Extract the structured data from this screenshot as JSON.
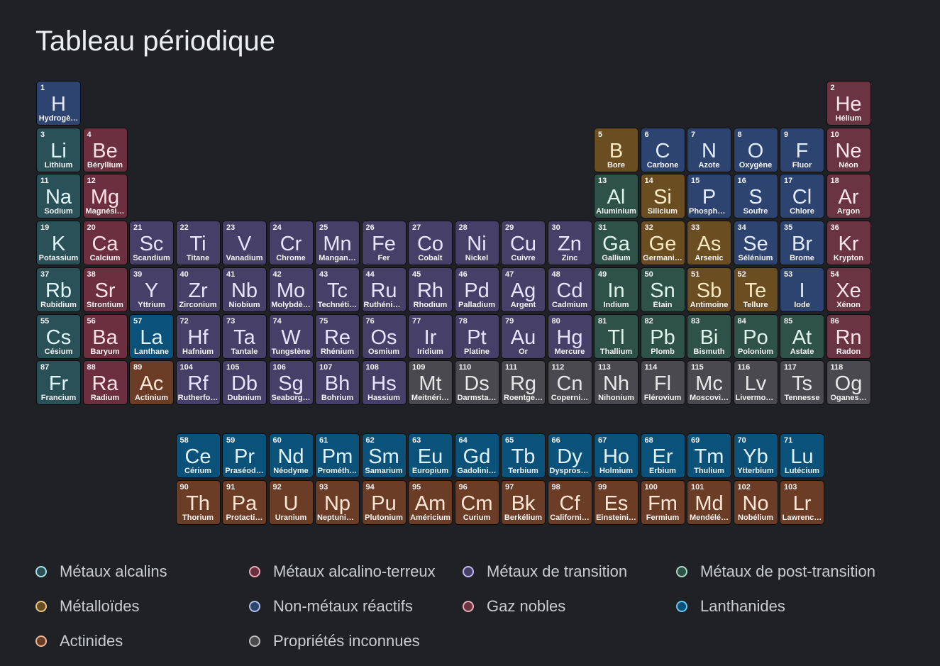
{
  "title": "Tableau périodique",
  "categories": {
    "alkali": {
      "label": "Métaux alcalins",
      "bg": "#2a5058",
      "fg": "#dff6f8",
      "dot": "#a8dfe4"
    },
    "alkaline": {
      "label": "Métaux alcalino-terreux",
      "bg": "#6c2f3f",
      "fg": "#ffe1e6",
      "dot": "#e8aab6"
    },
    "transition": {
      "label": "Métaux de transition",
      "bg": "#463f68",
      "fg": "#e8e4ff",
      "dot": "#c4b8f0"
    },
    "post": {
      "label": "Métaux de post-transition",
      "bg": "#2f5248",
      "fg": "#def3ea",
      "dot": "#a8d8c4"
    },
    "metalloid": {
      "label": "Métalloïdes",
      "bg": "#6b4d22",
      "fg": "#fbe9c2",
      "dot": "#e2c98a"
    },
    "nonmetal": {
      "label": "Non-métaux réactifs",
      "bg": "#2e4470",
      "fg": "#e2eaff",
      "dot": "#aebfe8"
    },
    "noble": {
      "label": "Gaz nobles",
      "bg": "#6a3442",
      "fg": "#ffe4ea",
      "dot": "#e6aebb"
    },
    "lanthanide": {
      "label": "Lanthanides",
      "bg": "#0b527a",
      "fg": "#dff2ff",
      "dot": "#6fc8ef"
    },
    "actinide": {
      "label": "Actinides",
      "bg": "#6b3c26",
      "fg": "#ffe6d4",
      "dot": "#eeb899"
    },
    "unknown": {
      "label": "Propriétés inconnues",
      "bg": "#4a4a4e",
      "fg": "#e6e6e6",
      "dot": "#bdbdbd"
    }
  },
  "legend_order": [
    "alkali",
    "alkaline",
    "transition",
    "post",
    "metalloid",
    "nonmetal",
    "noble",
    "lanthanide",
    "actinide",
    "unknown"
  ],
  "elements": [
    {
      "n": 1,
      "s": "H",
      "name": "Hydrogè…",
      "cat": "nonmetal",
      "row": 1,
      "col": 1
    },
    {
      "n": 2,
      "s": "He",
      "name": "Hélium",
      "cat": "noble",
      "row": 1,
      "col": 18
    },
    {
      "n": 3,
      "s": "Li",
      "name": "Lithium",
      "cat": "alkali",
      "row": 2,
      "col": 1
    },
    {
      "n": 4,
      "s": "Be",
      "name": "Béryllium",
      "cat": "alkaline",
      "row": 2,
      "col": 2
    },
    {
      "n": 5,
      "s": "B",
      "name": "Bore",
      "cat": "metalloid",
      "row": 2,
      "col": 13
    },
    {
      "n": 6,
      "s": "C",
      "name": "Carbone",
      "cat": "nonmetal",
      "row": 2,
      "col": 14
    },
    {
      "n": 7,
      "s": "N",
      "name": "Azote",
      "cat": "nonmetal",
      "row": 2,
      "col": 15
    },
    {
      "n": 8,
      "s": "O",
      "name": "Oxygène",
      "cat": "nonmetal",
      "row": 2,
      "col": 16
    },
    {
      "n": 9,
      "s": "F",
      "name": "Fluor",
      "cat": "nonmetal",
      "row": 2,
      "col": 17
    },
    {
      "n": 10,
      "s": "Ne",
      "name": "Néon",
      "cat": "noble",
      "row": 2,
      "col": 18
    },
    {
      "n": 11,
      "s": "Na",
      "name": "Sodium",
      "cat": "alkali",
      "row": 3,
      "col": 1
    },
    {
      "n": 12,
      "s": "Mg",
      "name": "Magnési…",
      "cat": "alkaline",
      "row": 3,
      "col": 2
    },
    {
      "n": 13,
      "s": "Al",
      "name": "Aluminium",
      "cat": "post",
      "row": 3,
      "col": 13
    },
    {
      "n": 14,
      "s": "Si",
      "name": "Silicium",
      "cat": "metalloid",
      "row": 3,
      "col": 14
    },
    {
      "n": 15,
      "s": "P",
      "name": "Phosphore",
      "cat": "nonmetal",
      "row": 3,
      "col": 15
    },
    {
      "n": 16,
      "s": "S",
      "name": "Soufre",
      "cat": "nonmetal",
      "row": 3,
      "col": 16
    },
    {
      "n": 17,
      "s": "Cl",
      "name": "Chlore",
      "cat": "nonmetal",
      "row": 3,
      "col": 17
    },
    {
      "n": 18,
      "s": "Ar",
      "name": "Argon",
      "cat": "noble",
      "row": 3,
      "col": 18
    },
    {
      "n": 19,
      "s": "K",
      "name": "Potassium",
      "cat": "alkali",
      "row": 4,
      "col": 1
    },
    {
      "n": 20,
      "s": "Ca",
      "name": "Calcium",
      "cat": "alkaline",
      "row": 4,
      "col": 2
    },
    {
      "n": 21,
      "s": "Sc",
      "name": "Scandium",
      "cat": "transition",
      "row": 4,
      "col": 3
    },
    {
      "n": 22,
      "s": "Ti",
      "name": "Titane",
      "cat": "transition",
      "row": 4,
      "col": 4
    },
    {
      "n": 23,
      "s": "V",
      "name": "Vanadium",
      "cat": "transition",
      "row": 4,
      "col": 5
    },
    {
      "n": 24,
      "s": "Cr",
      "name": "Chrome",
      "cat": "transition",
      "row": 4,
      "col": 6
    },
    {
      "n": 25,
      "s": "Mn",
      "name": "Mangan…",
      "cat": "transition",
      "row": 4,
      "col": 7
    },
    {
      "n": 26,
      "s": "Fe",
      "name": "Fer",
      "cat": "transition",
      "row": 4,
      "col": 8
    },
    {
      "n": 27,
      "s": "Co",
      "name": "Cobalt",
      "cat": "transition",
      "row": 4,
      "col": 9
    },
    {
      "n": 28,
      "s": "Ni",
      "name": "Nickel",
      "cat": "transition",
      "row": 4,
      "col": 10
    },
    {
      "n": 29,
      "s": "Cu",
      "name": "Cuivre",
      "cat": "transition",
      "row": 4,
      "col": 11
    },
    {
      "n": 30,
      "s": "Zn",
      "name": "Zinc",
      "cat": "transition",
      "row": 4,
      "col": 12
    },
    {
      "n": 31,
      "s": "Ga",
      "name": "Gallium",
      "cat": "post",
      "row": 4,
      "col": 13
    },
    {
      "n": 32,
      "s": "Ge",
      "name": "Germani…",
      "cat": "metalloid",
      "row": 4,
      "col": 14
    },
    {
      "n": 33,
      "s": "As",
      "name": "Arsenic",
      "cat": "metalloid",
      "row": 4,
      "col": 15
    },
    {
      "n": 34,
      "s": "Se",
      "name": "Sélénium",
      "cat": "nonmetal",
      "row": 4,
      "col": 16
    },
    {
      "n": 35,
      "s": "Br",
      "name": "Brome",
      "cat": "nonmetal",
      "row": 4,
      "col": 17
    },
    {
      "n": 36,
      "s": "Kr",
      "name": "Krypton",
      "cat": "noble",
      "row": 4,
      "col": 18
    },
    {
      "n": 37,
      "s": "Rb",
      "name": "Rubidium",
      "cat": "alkali",
      "row": 5,
      "col": 1
    },
    {
      "n": 38,
      "s": "Sr",
      "name": "Strontium",
      "cat": "alkaline",
      "row": 5,
      "col": 2
    },
    {
      "n": 39,
      "s": "Y",
      "name": "Yttrium",
      "cat": "transition",
      "row": 5,
      "col": 3
    },
    {
      "n": 40,
      "s": "Zr",
      "name": "Zirconium",
      "cat": "transition",
      "row": 5,
      "col": 4
    },
    {
      "n": 41,
      "s": "Nb",
      "name": "Niobium",
      "cat": "transition",
      "row": 5,
      "col": 5
    },
    {
      "n": 42,
      "s": "Mo",
      "name": "Molybdè…",
      "cat": "transition",
      "row": 5,
      "col": 6
    },
    {
      "n": 43,
      "s": "Tc",
      "name": "Technéti…",
      "cat": "transition",
      "row": 5,
      "col": 7
    },
    {
      "n": 44,
      "s": "Ru",
      "name": "Ruthénium",
      "cat": "transition",
      "row": 5,
      "col": 8
    },
    {
      "n": 45,
      "s": "Rh",
      "name": "Rhodium",
      "cat": "transition",
      "row": 5,
      "col": 9
    },
    {
      "n": 46,
      "s": "Pd",
      "name": "Palladium",
      "cat": "transition",
      "row": 5,
      "col": 10
    },
    {
      "n": 47,
      "s": "Ag",
      "name": "Argent",
      "cat": "transition",
      "row": 5,
      "col": 11
    },
    {
      "n": 48,
      "s": "Cd",
      "name": "Cadmium",
      "cat": "transition",
      "row": 5,
      "col": 12
    },
    {
      "n": 49,
      "s": "In",
      "name": "Indium",
      "cat": "post",
      "row": 5,
      "col": 13
    },
    {
      "n": 50,
      "s": "Sn",
      "name": "Étain",
      "cat": "post",
      "row": 5,
      "col": 14
    },
    {
      "n": 51,
      "s": "Sb",
      "name": "Antimoine",
      "cat": "metalloid",
      "row": 5,
      "col": 15
    },
    {
      "n": 52,
      "s": "Te",
      "name": "Tellure",
      "cat": "metalloid",
      "row": 5,
      "col": 16
    },
    {
      "n": 53,
      "s": "I",
      "name": "Iode",
      "cat": "nonmetal",
      "row": 5,
      "col": 17
    },
    {
      "n": 54,
      "s": "Xe",
      "name": "Xénon",
      "cat": "noble",
      "row": 5,
      "col": 18
    },
    {
      "n": 55,
      "s": "Cs",
      "name": "Césium",
      "cat": "alkali",
      "row": 6,
      "col": 1
    },
    {
      "n": 56,
      "s": "Ba",
      "name": "Baryum",
      "cat": "alkaline",
      "row": 6,
      "col": 2
    },
    {
      "n": 57,
      "s": "La",
      "name": "Lanthane",
      "cat": "lanthanide",
      "row": 6,
      "col": 3
    },
    {
      "n": 72,
      "s": "Hf",
      "name": "Hafnium",
      "cat": "transition",
      "row": 6,
      "col": 4
    },
    {
      "n": 73,
      "s": "Ta",
      "name": "Tantale",
      "cat": "transition",
      "row": 6,
      "col": 5
    },
    {
      "n": 74,
      "s": "W",
      "name": "Tungstène",
      "cat": "transition",
      "row": 6,
      "col": 6
    },
    {
      "n": 75,
      "s": "Re",
      "name": "Rhénium",
      "cat": "transition",
      "row": 6,
      "col": 7
    },
    {
      "n": 76,
      "s": "Os",
      "name": "Osmium",
      "cat": "transition",
      "row": 6,
      "col": 8
    },
    {
      "n": 77,
      "s": "Ir",
      "name": "Iridium",
      "cat": "transition",
      "row": 6,
      "col": 9
    },
    {
      "n": 78,
      "s": "Pt",
      "name": "Platine",
      "cat": "transition",
      "row": 6,
      "col": 10
    },
    {
      "n": 79,
      "s": "Au",
      "name": "Or",
      "cat": "transition",
      "row": 6,
      "col": 11
    },
    {
      "n": 80,
      "s": "Hg",
      "name": "Mercure",
      "cat": "transition",
      "row": 6,
      "col": 12
    },
    {
      "n": 81,
      "s": "Tl",
      "name": "Thallium",
      "cat": "post",
      "row": 6,
      "col": 13
    },
    {
      "n": 82,
      "s": "Pb",
      "name": "Plomb",
      "cat": "post",
      "row": 6,
      "col": 14
    },
    {
      "n": 83,
      "s": "Bi",
      "name": "Bismuth",
      "cat": "post",
      "row": 6,
      "col": 15
    },
    {
      "n": 84,
      "s": "Po",
      "name": "Polonium",
      "cat": "post",
      "row": 6,
      "col": 16
    },
    {
      "n": 85,
      "s": "At",
      "name": "Astate",
      "cat": "post",
      "row": 6,
      "col": 17
    },
    {
      "n": 86,
      "s": "Rn",
      "name": "Radon",
      "cat": "noble",
      "row": 6,
      "col": 18
    },
    {
      "n": 87,
      "s": "Fr",
      "name": "Francium",
      "cat": "alkali",
      "row": 7,
      "col": 1
    },
    {
      "n": 88,
      "s": "Ra",
      "name": "Radium",
      "cat": "alkaline",
      "row": 7,
      "col": 2
    },
    {
      "n": 89,
      "s": "Ac",
      "name": "Actinium",
      "cat": "actinide",
      "row": 7,
      "col": 3
    },
    {
      "n": 104,
      "s": "Rf",
      "name": "Rutherfo…",
      "cat": "transition",
      "row": 7,
      "col": 4
    },
    {
      "n": 105,
      "s": "Db",
      "name": "Dubnium",
      "cat": "transition",
      "row": 7,
      "col": 5
    },
    {
      "n": 106,
      "s": "Sg",
      "name": "Seaborg…",
      "cat": "transition",
      "row": 7,
      "col": 6
    },
    {
      "n": 107,
      "s": "Bh",
      "name": "Bohrium",
      "cat": "transition",
      "row": 7,
      "col": 7
    },
    {
      "n": 108,
      "s": "Hs",
      "name": "Hassium",
      "cat": "transition",
      "row": 7,
      "col": 8
    },
    {
      "n": 109,
      "s": "Mt",
      "name": "Meitnéri…",
      "cat": "unknown",
      "row": 7,
      "col": 9
    },
    {
      "n": 110,
      "s": "Ds",
      "name": "Darmsta…",
      "cat": "unknown",
      "row": 7,
      "col": 10
    },
    {
      "n": 111,
      "s": "Rg",
      "name": "Roentge…",
      "cat": "unknown",
      "row": 7,
      "col": 11
    },
    {
      "n": 112,
      "s": "Cn",
      "name": "Coperni…",
      "cat": "unknown",
      "row": 7,
      "col": 12
    },
    {
      "n": 113,
      "s": "Nh",
      "name": "Nihonium",
      "cat": "unknown",
      "row": 7,
      "col": 13
    },
    {
      "n": 114,
      "s": "Fl",
      "name": "Flérovium",
      "cat": "unknown",
      "row": 7,
      "col": 14
    },
    {
      "n": 115,
      "s": "Mc",
      "name": "Moscovi…",
      "cat": "unknown",
      "row": 7,
      "col": 15
    },
    {
      "n": 116,
      "s": "Lv",
      "name": "Livermor…",
      "cat": "unknown",
      "row": 7,
      "col": 16
    },
    {
      "n": 117,
      "s": "Ts",
      "name": "Tennesse",
      "cat": "unknown",
      "row": 7,
      "col": 17
    },
    {
      "n": 118,
      "s": "Og",
      "name": "Oganes…",
      "cat": "unknown",
      "row": 7,
      "col": 18
    },
    {
      "n": 58,
      "s": "Ce",
      "name": "Cérium",
      "cat": "lanthanide",
      "row": 9,
      "col": 4
    },
    {
      "n": 59,
      "s": "Pr",
      "name": "Praséod…",
      "cat": "lanthanide",
      "row": 9,
      "col": 5
    },
    {
      "n": 60,
      "s": "Nd",
      "name": "Néodyme",
      "cat": "lanthanide",
      "row": 9,
      "col": 6
    },
    {
      "n": 61,
      "s": "Pm",
      "name": "Prométh…",
      "cat": "lanthanide",
      "row": 9,
      "col": 7
    },
    {
      "n": 62,
      "s": "Sm",
      "name": "Samarium",
      "cat": "lanthanide",
      "row": 9,
      "col": 8
    },
    {
      "n": 63,
      "s": "Eu",
      "name": "Europium",
      "cat": "lanthanide",
      "row": 9,
      "col": 9
    },
    {
      "n": 64,
      "s": "Gd",
      "name": "Gadolini…",
      "cat": "lanthanide",
      "row": 9,
      "col": 10
    },
    {
      "n": 65,
      "s": "Tb",
      "name": "Terbium",
      "cat": "lanthanide",
      "row": 9,
      "col": 11
    },
    {
      "n": 66,
      "s": "Dy",
      "name": "Dysprosi…",
      "cat": "lanthanide",
      "row": 9,
      "col": 12
    },
    {
      "n": 67,
      "s": "Ho",
      "name": "Holmium",
      "cat": "lanthanide",
      "row": 9,
      "col": 13
    },
    {
      "n": 68,
      "s": "Er",
      "name": "Erbium",
      "cat": "lanthanide",
      "row": 9,
      "col": 14
    },
    {
      "n": 69,
      "s": "Tm",
      "name": "Thulium",
      "cat": "lanthanide",
      "row": 9,
      "col": 15
    },
    {
      "n": 70,
      "s": "Yb",
      "name": "Ytterbium",
      "cat": "lanthanide",
      "row": 9,
      "col": 16
    },
    {
      "n": 71,
      "s": "Lu",
      "name": "Lutécium",
      "cat": "lanthanide",
      "row": 9,
      "col": 17
    },
    {
      "n": 90,
      "s": "Th",
      "name": "Thorium",
      "cat": "actinide",
      "row": 10,
      "col": 4
    },
    {
      "n": 91,
      "s": "Pa",
      "name": "Protacti…",
      "cat": "actinide",
      "row": 10,
      "col": 5
    },
    {
      "n": 92,
      "s": "U",
      "name": "Uranium",
      "cat": "actinide",
      "row": 10,
      "col": 6
    },
    {
      "n": 93,
      "s": "Np",
      "name": "Neptunium",
      "cat": "actinide",
      "row": 10,
      "col": 7
    },
    {
      "n": 94,
      "s": "Pu",
      "name": "Plutonium",
      "cat": "actinide",
      "row": 10,
      "col": 8
    },
    {
      "n": 95,
      "s": "Am",
      "name": "Américium",
      "cat": "actinide",
      "row": 10,
      "col": 9
    },
    {
      "n": 96,
      "s": "Cm",
      "name": "Curium",
      "cat": "actinide",
      "row": 10,
      "col": 10
    },
    {
      "n": 97,
      "s": "Bk",
      "name": "Berkélium",
      "cat": "actinide",
      "row": 10,
      "col": 11
    },
    {
      "n": 98,
      "s": "Cf",
      "name": "Californi…",
      "cat": "actinide",
      "row": 10,
      "col": 12
    },
    {
      "n": 99,
      "s": "Es",
      "name": "Einsteini…",
      "cat": "actinide",
      "row": 10,
      "col": 13
    },
    {
      "n": 100,
      "s": "Fm",
      "name": "Fermium",
      "cat": "actinide",
      "row": 10,
      "col": 14
    },
    {
      "n": 101,
      "s": "Md",
      "name": "Mendélé…",
      "cat": "actinide",
      "row": 10,
      "col": 15
    },
    {
      "n": 102,
      "s": "No",
      "name": "Nobélium",
      "cat": "actinide",
      "row": 10,
      "col": 16
    },
    {
      "n": 103,
      "s": "Lr",
      "name": "Lawrenc…",
      "cat": "actinide",
      "row": 10,
      "col": 17
    }
  ]
}
